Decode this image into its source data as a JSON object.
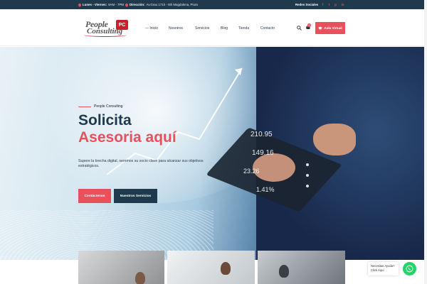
{
  "topbar": {
    "hours_label": "Lunes - Viernes:",
    "hours_value": "9AM - 7PM",
    "address_label": "Dirección:",
    "address_value": "Av.Grau 1710 - 6th Magdalena, Piura",
    "social_label": "Redes Sociales",
    "social_icons": [
      "facebook-icon",
      "twitter-icon",
      "pinterest-icon",
      "linkedin-icon"
    ]
  },
  "header": {
    "logo_line1": "People",
    "logo_line2": "Consulting",
    "logo_badge": "PC",
    "nav": [
      "— Inicio",
      "Nosotros",
      "Servicios",
      "Blog",
      "Tienda",
      "Contacto"
    ],
    "cart_count": "0",
    "aula_button": "Aula Virtual"
  },
  "hero": {
    "pretitle": "People Consulting",
    "title_line1": "Solicita",
    "title_line2": "Asesoria aquí",
    "description": "Supere la brecha digital, seremos su socio clave para alcanzar sus objetivos estratégicos.",
    "btn_primary": "Contáctenos",
    "btn_secondary": "Nuestros Servicios",
    "numbers": [
      "210.95",
      "149.16",
      "23.26",
      "1.41%"
    ]
  },
  "chat": {
    "text": "Necesitas Ayuda? Click Aquí"
  },
  "colors": {
    "accent": "#e8505b",
    "navy": "#1f3a4d",
    "whatsapp": "#25d366"
  }
}
